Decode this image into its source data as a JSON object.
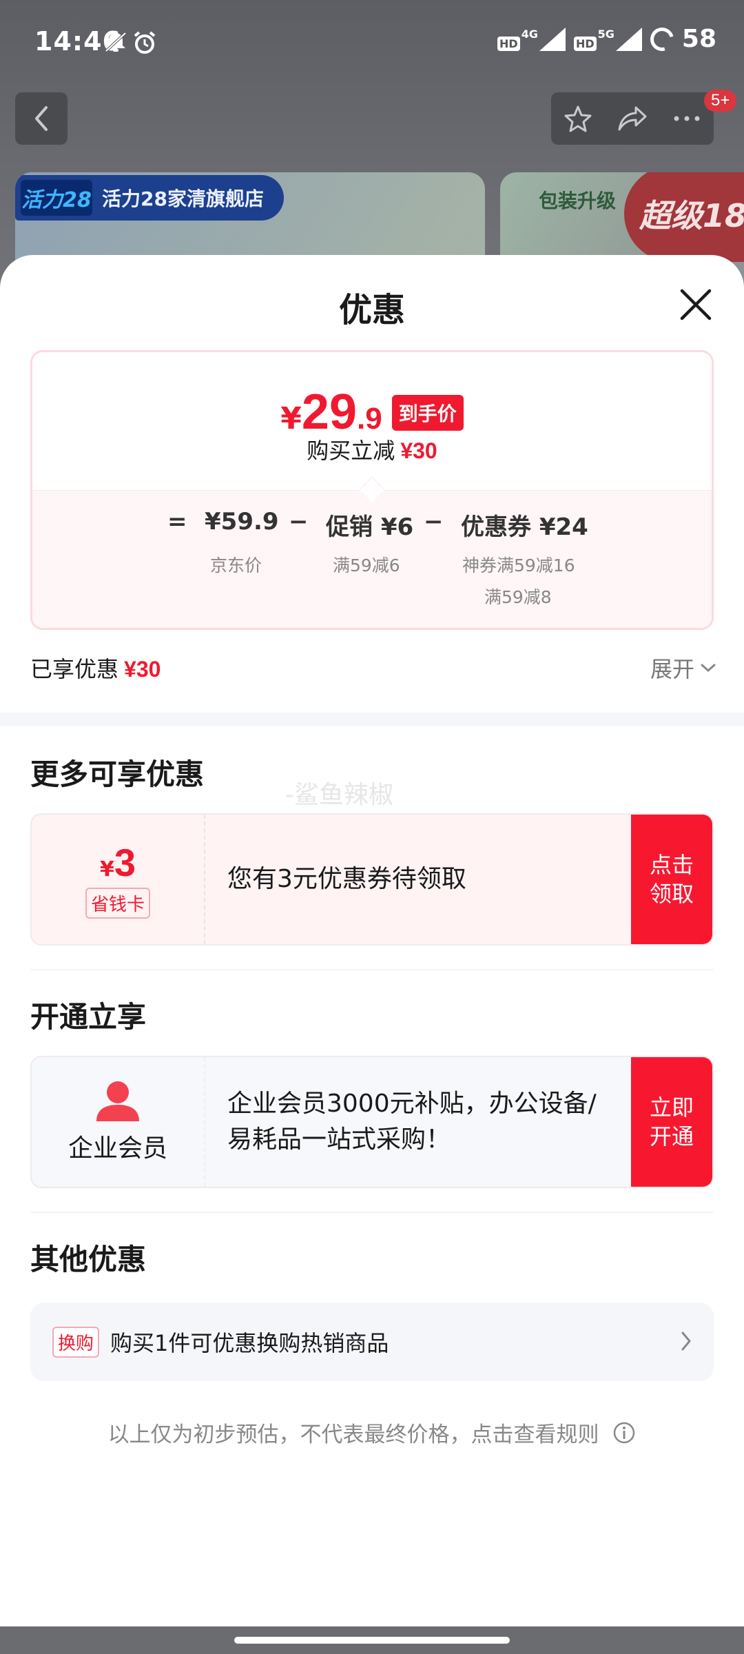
{
  "status_bar": {
    "time": "14:46",
    "battery": "58",
    "net1": "4G",
    "net2": "5G",
    "hd": "HD"
  },
  "header": {
    "cart_badge": "5+"
  },
  "background": {
    "store_logo": "活力28",
    "store_name": "活力28家清旗舰店",
    "right_card_text": "包装升级",
    "right_card_promo": "超级18"
  },
  "sheet": {
    "title": "优惠",
    "final_price": {
      "currency": "¥",
      "integer": "29",
      "decimal": ".9",
      "tag": "到手价"
    },
    "buy_reduce": {
      "label": "购买立减",
      "amount": "¥30"
    },
    "breakdown": {
      "equals": "=",
      "jd_price": "¥59.9",
      "jd_price_label": "京东价",
      "minus1": "−",
      "promo": "促销 ¥6",
      "promo_detail": "满59减6",
      "minus2": "−",
      "coupon": "优惠券 ¥24",
      "coupon_detail_1": "神券满59减16",
      "coupon_detail_2": "满59减8"
    },
    "enjoyed": {
      "label": "已享优惠",
      "amount": "¥30"
    },
    "expand_label": "展开",
    "more_offers": {
      "title": "更多可享优惠",
      "watermark": "-鲨鱼辣椒",
      "card": {
        "currency": "¥",
        "amount": "3",
        "tag": "省钱卡",
        "text": "您有3元优惠券待领取",
        "button": "点击领取"
      }
    },
    "open_enjoy": {
      "title": "开通立享",
      "card": {
        "label": "企业会员",
        "text": " 企业会员3000元补贴，办公设备/易耗品一站式采购！",
        "button": "立即开通"
      }
    },
    "other_offers": {
      "title": "其他优惠",
      "swap": {
        "tag": "换购",
        "text": "购买1件可优惠换购热销商品"
      }
    },
    "footnote": "以上仅为初步预估，不代表最终价格，点击查看规则"
  },
  "colors": {
    "accent": "#f0192f",
    "button_red": "#f71830",
    "pink_bg": "#fff3f4"
  }
}
